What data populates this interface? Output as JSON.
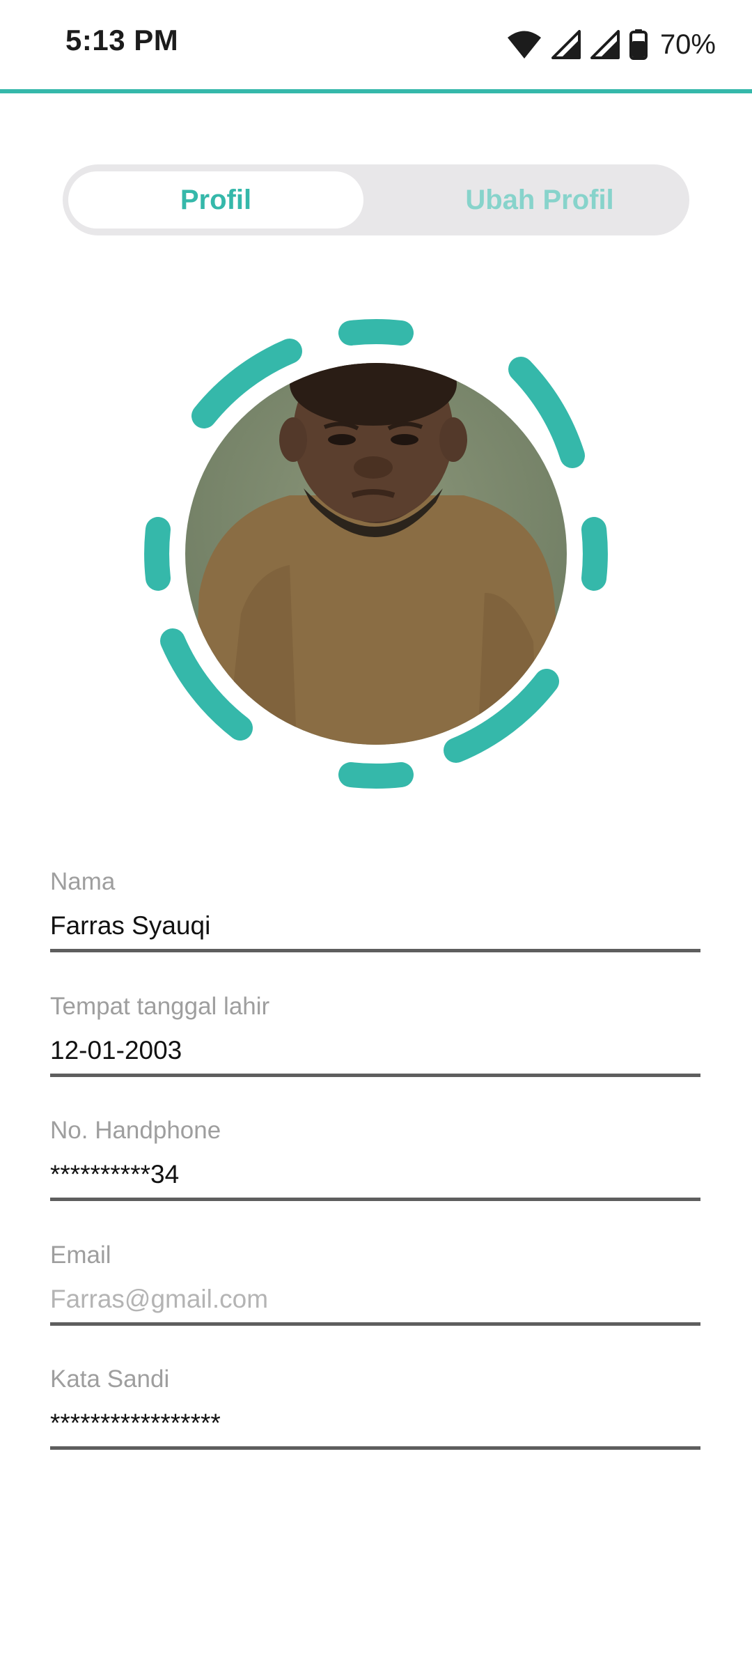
{
  "status_bar": {
    "time": "5:13 PM",
    "battery": "70%",
    "icons": [
      "wifi-icon",
      "signal-icon",
      "signal-icon",
      "battery-icon"
    ]
  },
  "colors": {
    "accent": "#35b8aa",
    "accent_light": "#87d3cb",
    "tab_track": "#e8e7e9",
    "label": "#9e9e9e",
    "underline": "#5e5e5e"
  },
  "tabs": {
    "profile": "Profil",
    "edit_profile": "Ubah Profil"
  },
  "form": {
    "name": {
      "label": "Nama",
      "value": "Farras Syauqi"
    },
    "birth": {
      "label": "Tempat tanggal lahir",
      "value": "12-01-2003"
    },
    "phone": {
      "label": "No. Handphone",
      "value": "**********34"
    },
    "email": {
      "label": "Email",
      "value": "Farras@gmail.com"
    },
    "password": {
      "label": "Kata Sandi",
      "value": "*****************"
    }
  }
}
